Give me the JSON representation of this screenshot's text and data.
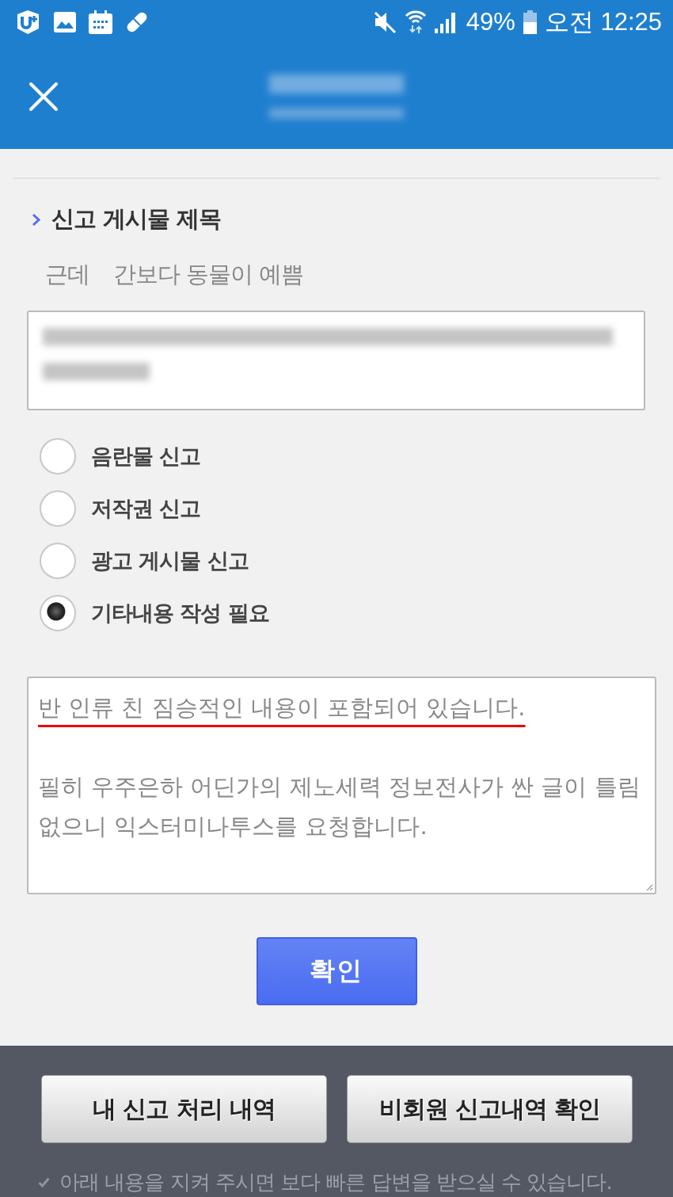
{
  "status_bar": {
    "battery": "49%",
    "time": "오전 12:25"
  },
  "report": {
    "section_title": "신고 게시물 제목",
    "post_title": [
      "근데",
      "간보다 동물이 예쁨"
    ],
    "reasons": [
      {
        "label": "음란물 신고",
        "selected": false
      },
      {
        "label": "저작권 신고",
        "selected": false
      },
      {
        "label": "광고 게시물 신고",
        "selected": false
      },
      {
        "label": "기타내용 작성 필요",
        "selected": true
      }
    ],
    "details": [
      {
        "text": "반 인류 친 짐승적인 내용이 포함되어 있습니다.",
        "spellcheck_flagged": true
      },
      {
        "text": "필히 우주은하 어딘가의 제노세력 정보전사가 싼 글이 틀림없으니 익스터미나투스를 요청합니다.",
        "spellcheck_flagged": false
      }
    ],
    "confirm_button": "확인"
  },
  "footer": {
    "buttons": [
      "내 신고 처리 내역",
      "비회원 신고내역 확인"
    ],
    "notice": "아래 내용을 지켜 주시면 보다 빠른 답변을 받으실 수 있습니다."
  }
}
